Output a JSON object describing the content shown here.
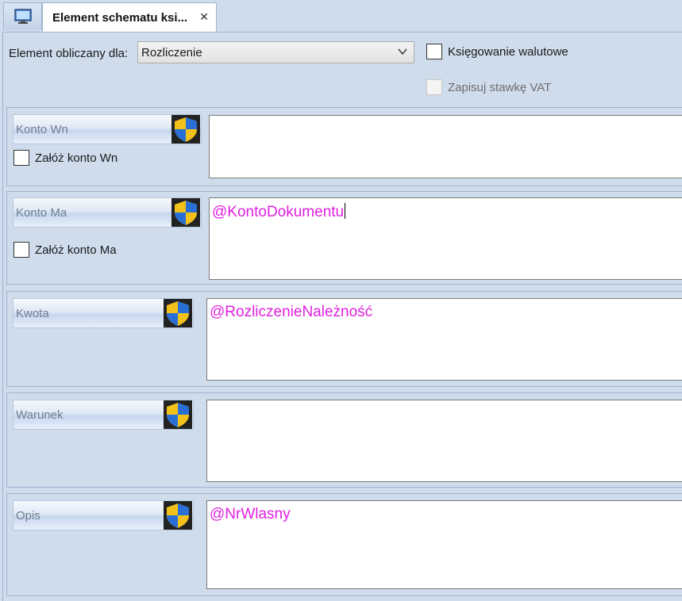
{
  "tab": {
    "icon": "monitor-icon",
    "title": "Element schematu ksi...",
    "close_glyph": "✕"
  },
  "header": {
    "computed_for_label": "Element obliczany dla:",
    "computed_for_value": "Rozliczenie",
    "currency_posting_label": "Księgowanie walutowe",
    "currency_posting_checked": false,
    "save_vat_rate_label": "Zapisuj stawkę VAT",
    "save_vat_rate_enabled": false
  },
  "fields": {
    "konto_wn": {
      "label": "Konto Wn",
      "value": "",
      "checkbox_label": "Załóż konto Wn"
    },
    "konto_ma": {
      "label": "Konto Ma",
      "value": "@KontoDokumentu",
      "checkbox_label": "Załóż konto Ma"
    },
    "kwota": {
      "label": "Kwota",
      "value": "@RozliczenieNależność"
    },
    "warunek": {
      "label": "Warunek",
      "value": ""
    },
    "opis": {
      "label": "Opis",
      "value": "@NrWlasny"
    }
  },
  "colors": {
    "background": "#cfdcec",
    "expression_text": "#e020e0",
    "shield_blue": "#2a6fd6",
    "shield_yellow": "#f2c21b"
  }
}
